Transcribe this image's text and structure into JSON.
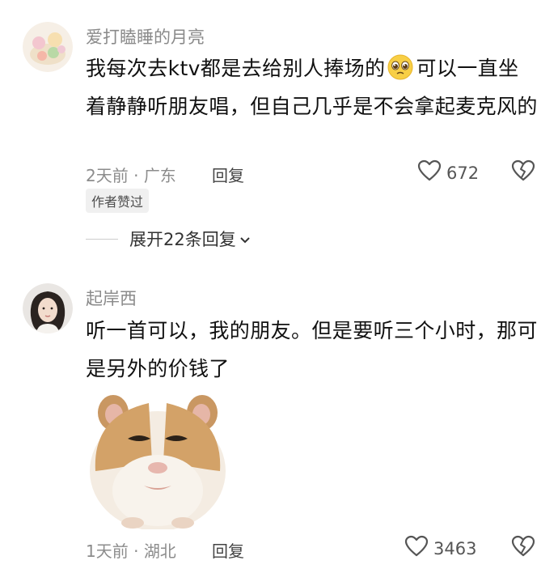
{
  "comments": [
    {
      "username": "爱打瞌睡的月亮",
      "text_before_emoji": "我每次去ktv都是去给别人捧场的",
      "text_after_emoji": "可以一直坐着静静听朋友唱，但自己几乎是不会拿起麦克风的",
      "time": "2天前",
      "location": "广东",
      "separator": "·",
      "reply_label": "回复",
      "likes": "672",
      "badge": "作者赞过",
      "expand_label": "展开22条回复",
      "icons": {
        "like": "heart-outline-icon",
        "dislike": "broken-heart-icon",
        "emoji": "pleading-face-emoji",
        "expand": "chevron-down-icon"
      }
    },
    {
      "username": "起岸西",
      "text": "听一首可以，我的朋友。但是要听三个小时，那可是另外的价钱了",
      "time": "1天前",
      "location": "湖北",
      "separator": "·",
      "reply_label": "回复",
      "likes": "3463",
      "icons": {
        "like": "heart-outline-icon",
        "dislike": "broken-heart-icon",
        "sticker": "hamster-meme-sticker"
      }
    }
  ]
}
